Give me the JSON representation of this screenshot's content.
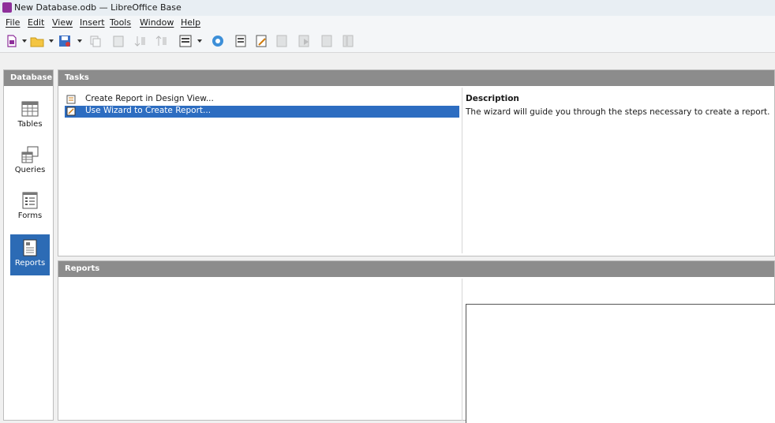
{
  "window": {
    "title": "New Database.odb — LibreOffice Base"
  },
  "menu": [
    "File",
    "Edit",
    "View",
    "Insert",
    "Tools",
    "Window",
    "Help"
  ],
  "toolbar": {
    "icons": [
      "new-document-icon",
      "open-folder-icon",
      "save-icon",
      "copy-icon",
      "paste-icon",
      "sort-ascending-icon",
      "sort-descending-icon",
      "form-icon",
      "help-icon",
      "report-icon",
      "report-edit-icon",
      "delete-icon",
      "rename-icon",
      "properties-icon",
      "query-icon"
    ]
  },
  "database_pane": {
    "header": "Database",
    "items": [
      {
        "label": "Tables",
        "icon": "table-icon"
      },
      {
        "label": "Queries",
        "icon": "query-icon"
      },
      {
        "label": "Forms",
        "icon": "form-icon"
      },
      {
        "label": "Reports",
        "icon": "report-icon",
        "selected": true
      }
    ]
  },
  "tasks": {
    "header": "Tasks",
    "items": [
      {
        "label": "Create Report in Design View...",
        "icon": "design-view-icon"
      },
      {
        "label": "Use Wizard to Create Report...",
        "icon": "wizard-icon",
        "selected": true
      }
    ],
    "description_title": "Description",
    "description_text": "The wizard will guide you through the steps necessary to create a report."
  },
  "reports": {
    "header": "Reports"
  },
  "colors": {
    "selection": "#2d6dc1",
    "nav_active": "#2c6bb5",
    "header_bg": "#8c8c8c"
  }
}
